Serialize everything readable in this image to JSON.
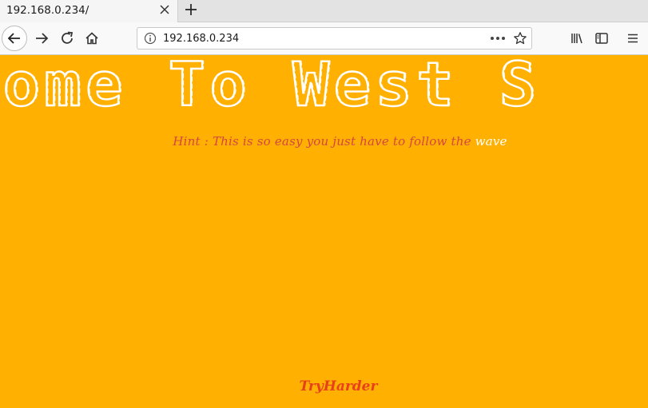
{
  "browser": {
    "tab_title": "192.168.0.234/",
    "url": "192.168.0.234"
  },
  "page": {
    "banner_text": "come To West S",
    "hint_prefix": "Hint : This is so easy you just have to follow the ",
    "hint_highlight": "wave",
    "footer_text": "TryHarder"
  },
  "colors": {
    "background": "#ffb000",
    "banner": "#ffffff",
    "hint": "#d64545",
    "footer": "#e8401c"
  }
}
